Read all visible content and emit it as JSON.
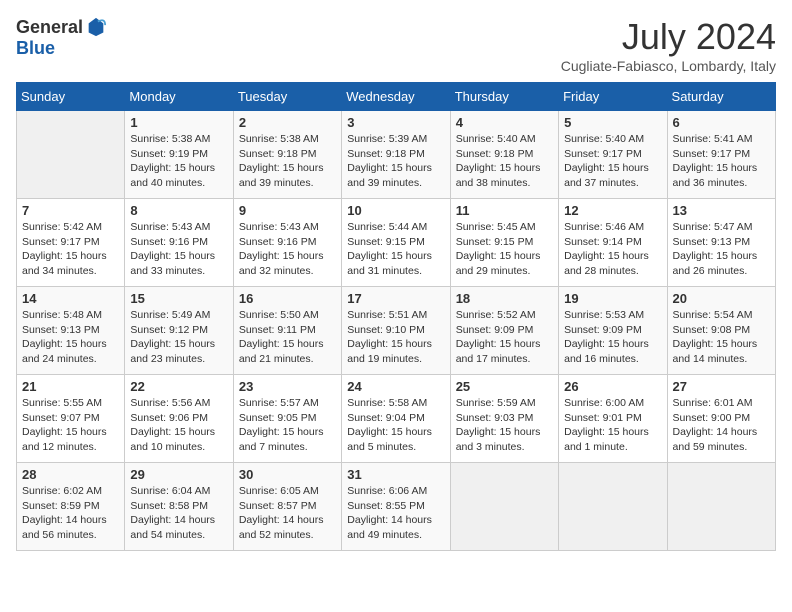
{
  "logo": {
    "general": "General",
    "blue": "Blue"
  },
  "title": "July 2024",
  "location": "Cugliate-Fabiasco, Lombardy, Italy",
  "days_of_week": [
    "Sunday",
    "Monday",
    "Tuesday",
    "Wednesday",
    "Thursday",
    "Friday",
    "Saturday"
  ],
  "weeks": [
    [
      {
        "day": "",
        "sunrise": "",
        "sunset": "",
        "daylight": ""
      },
      {
        "day": "1",
        "sunrise": "Sunrise: 5:38 AM",
        "sunset": "Sunset: 9:19 PM",
        "daylight": "Daylight: 15 hours and 40 minutes."
      },
      {
        "day": "2",
        "sunrise": "Sunrise: 5:38 AM",
        "sunset": "Sunset: 9:18 PM",
        "daylight": "Daylight: 15 hours and 39 minutes."
      },
      {
        "day": "3",
        "sunrise": "Sunrise: 5:39 AM",
        "sunset": "Sunset: 9:18 PM",
        "daylight": "Daylight: 15 hours and 39 minutes."
      },
      {
        "day": "4",
        "sunrise": "Sunrise: 5:40 AM",
        "sunset": "Sunset: 9:18 PM",
        "daylight": "Daylight: 15 hours and 38 minutes."
      },
      {
        "day": "5",
        "sunrise": "Sunrise: 5:40 AM",
        "sunset": "Sunset: 9:17 PM",
        "daylight": "Daylight: 15 hours and 37 minutes."
      },
      {
        "day": "6",
        "sunrise": "Sunrise: 5:41 AM",
        "sunset": "Sunset: 9:17 PM",
        "daylight": "Daylight: 15 hours and 36 minutes."
      }
    ],
    [
      {
        "day": "7",
        "sunrise": "Sunrise: 5:42 AM",
        "sunset": "Sunset: 9:17 PM",
        "daylight": "Daylight: 15 hours and 34 minutes."
      },
      {
        "day": "8",
        "sunrise": "Sunrise: 5:43 AM",
        "sunset": "Sunset: 9:16 PM",
        "daylight": "Daylight: 15 hours and 33 minutes."
      },
      {
        "day": "9",
        "sunrise": "Sunrise: 5:43 AM",
        "sunset": "Sunset: 9:16 PM",
        "daylight": "Daylight: 15 hours and 32 minutes."
      },
      {
        "day": "10",
        "sunrise": "Sunrise: 5:44 AM",
        "sunset": "Sunset: 9:15 PM",
        "daylight": "Daylight: 15 hours and 31 minutes."
      },
      {
        "day": "11",
        "sunrise": "Sunrise: 5:45 AM",
        "sunset": "Sunset: 9:15 PM",
        "daylight": "Daylight: 15 hours and 29 minutes."
      },
      {
        "day": "12",
        "sunrise": "Sunrise: 5:46 AM",
        "sunset": "Sunset: 9:14 PM",
        "daylight": "Daylight: 15 hours and 28 minutes."
      },
      {
        "day": "13",
        "sunrise": "Sunrise: 5:47 AM",
        "sunset": "Sunset: 9:13 PM",
        "daylight": "Daylight: 15 hours and 26 minutes."
      }
    ],
    [
      {
        "day": "14",
        "sunrise": "Sunrise: 5:48 AM",
        "sunset": "Sunset: 9:13 PM",
        "daylight": "Daylight: 15 hours and 24 minutes."
      },
      {
        "day": "15",
        "sunrise": "Sunrise: 5:49 AM",
        "sunset": "Sunset: 9:12 PM",
        "daylight": "Daylight: 15 hours and 23 minutes."
      },
      {
        "day": "16",
        "sunrise": "Sunrise: 5:50 AM",
        "sunset": "Sunset: 9:11 PM",
        "daylight": "Daylight: 15 hours and 21 minutes."
      },
      {
        "day": "17",
        "sunrise": "Sunrise: 5:51 AM",
        "sunset": "Sunset: 9:10 PM",
        "daylight": "Daylight: 15 hours and 19 minutes."
      },
      {
        "day": "18",
        "sunrise": "Sunrise: 5:52 AM",
        "sunset": "Sunset: 9:09 PM",
        "daylight": "Daylight: 15 hours and 17 minutes."
      },
      {
        "day": "19",
        "sunrise": "Sunrise: 5:53 AM",
        "sunset": "Sunset: 9:09 PM",
        "daylight": "Daylight: 15 hours and 16 minutes."
      },
      {
        "day": "20",
        "sunrise": "Sunrise: 5:54 AM",
        "sunset": "Sunset: 9:08 PM",
        "daylight": "Daylight: 15 hours and 14 minutes."
      }
    ],
    [
      {
        "day": "21",
        "sunrise": "Sunrise: 5:55 AM",
        "sunset": "Sunset: 9:07 PM",
        "daylight": "Daylight: 15 hours and 12 minutes."
      },
      {
        "day": "22",
        "sunrise": "Sunrise: 5:56 AM",
        "sunset": "Sunset: 9:06 PM",
        "daylight": "Daylight: 15 hours and 10 minutes."
      },
      {
        "day": "23",
        "sunrise": "Sunrise: 5:57 AM",
        "sunset": "Sunset: 9:05 PM",
        "daylight": "Daylight: 15 hours and 7 minutes."
      },
      {
        "day": "24",
        "sunrise": "Sunrise: 5:58 AM",
        "sunset": "Sunset: 9:04 PM",
        "daylight": "Daylight: 15 hours and 5 minutes."
      },
      {
        "day": "25",
        "sunrise": "Sunrise: 5:59 AM",
        "sunset": "Sunset: 9:03 PM",
        "daylight": "Daylight: 15 hours and 3 minutes."
      },
      {
        "day": "26",
        "sunrise": "Sunrise: 6:00 AM",
        "sunset": "Sunset: 9:01 PM",
        "daylight": "Daylight: 15 hours and 1 minute."
      },
      {
        "day": "27",
        "sunrise": "Sunrise: 6:01 AM",
        "sunset": "Sunset: 9:00 PM",
        "daylight": "Daylight: 14 hours and 59 minutes."
      }
    ],
    [
      {
        "day": "28",
        "sunrise": "Sunrise: 6:02 AM",
        "sunset": "Sunset: 8:59 PM",
        "daylight": "Daylight: 14 hours and 56 minutes."
      },
      {
        "day": "29",
        "sunrise": "Sunrise: 6:04 AM",
        "sunset": "Sunset: 8:58 PM",
        "daylight": "Daylight: 14 hours and 54 minutes."
      },
      {
        "day": "30",
        "sunrise": "Sunrise: 6:05 AM",
        "sunset": "Sunset: 8:57 PM",
        "daylight": "Daylight: 14 hours and 52 minutes."
      },
      {
        "day": "31",
        "sunrise": "Sunrise: 6:06 AM",
        "sunset": "Sunset: 8:55 PM",
        "daylight": "Daylight: 14 hours and 49 minutes."
      },
      {
        "day": "",
        "sunrise": "",
        "sunset": "",
        "daylight": ""
      },
      {
        "day": "",
        "sunrise": "",
        "sunset": "",
        "daylight": ""
      },
      {
        "day": "",
        "sunrise": "",
        "sunset": "",
        "daylight": ""
      }
    ]
  ]
}
